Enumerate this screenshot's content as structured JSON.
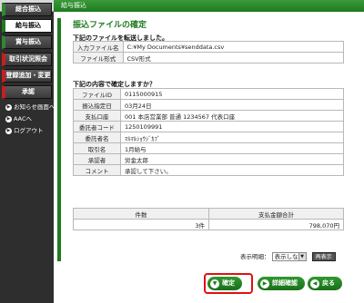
{
  "header": {
    "title": "給与振込"
  },
  "sidebar": {
    "items": [
      {
        "label": "総合振込"
      },
      {
        "label": "給与振込"
      },
      {
        "label": "賞与振込"
      },
      {
        "label": "取引状況照会"
      },
      {
        "label": "登録追加・変更"
      },
      {
        "label": "承認"
      }
    ],
    "links": [
      {
        "label": "お知らせ画面へ"
      },
      {
        "label": "AACへ"
      },
      {
        "label": "ログアウト"
      }
    ]
  },
  "main": {
    "title": "振込ファイルの確定",
    "subtitle_file": "下記のファイルを転送しました。",
    "file_info": [
      {
        "label": "入力ファイル名",
        "value": "C:¥My Documents¥senddata.csv"
      },
      {
        "label": "ファイル形式",
        "value": "CSV形式"
      }
    ],
    "subtitle_confirm": "下記の内容で確定しますか？",
    "details": [
      {
        "label": "ファイルID",
        "value": "0115000915"
      },
      {
        "label": "振込指定日",
        "value": "03月24日"
      },
      {
        "label": "支払口座",
        "value": "001 本店営業部 普通 1234567 代表口座"
      },
      {
        "label": "委託者コード",
        "value": "1250109991"
      },
      {
        "label": "委託者名",
        "value": "ﾏﾙﾏﾙｼｮｳｼﾞｶﾌﾞ"
      },
      {
        "label": "取引名",
        "value": "1月給与"
      },
      {
        "label": "承認者",
        "value": "労金太郎"
      },
      {
        "label": "コメント",
        "value": "承認して下さい。"
      }
    ],
    "totals": {
      "headers": [
        "件数",
        "支払金額合計"
      ],
      "values": [
        "3件",
        "798,070円"
      ]
    },
    "display": {
      "label": "表示明細：",
      "selected": "表示しない",
      "redisplay_label": "再表示"
    },
    "buttons": {
      "confirm": "確定",
      "detail": "詳細確認",
      "back": "戻る"
    }
  }
}
